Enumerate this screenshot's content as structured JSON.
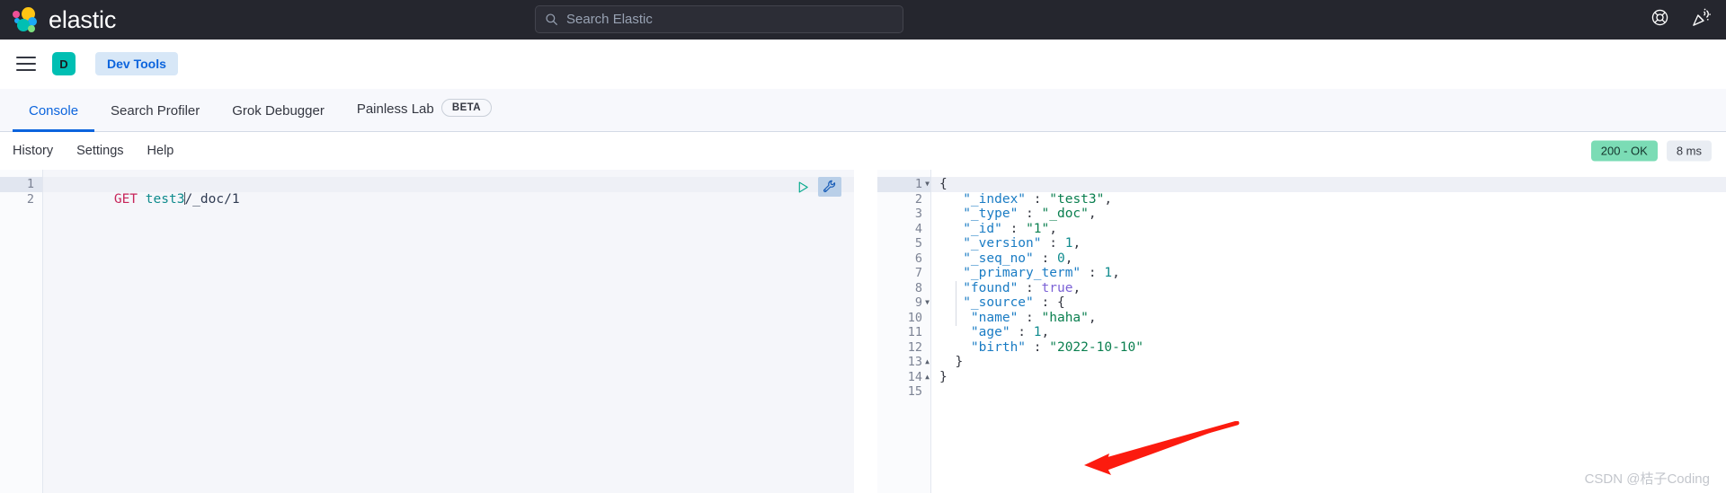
{
  "topbar": {
    "brand": "elastic",
    "logo_colors": {
      "pink": "#ee5097",
      "yellow": "#fec514",
      "cyan": "#1ba9f5",
      "teal": "#00bfb3",
      "green": "#7de07d"
    },
    "search": {
      "placeholder": "Search Elastic",
      "value": ""
    },
    "icons": [
      "help-lifebuoy-icon",
      "confetti-icon"
    ],
    "background": "#25262e"
  },
  "navbar": {
    "menu_icon": "hamburger-menu-icon",
    "avatar_initial": "D",
    "avatar_color": "#00bfb3",
    "breadcrumb": "Dev Tools",
    "breadcrumb_color": "#0b64dd"
  },
  "tabs": {
    "items": [
      {
        "label": "Console",
        "active": true
      },
      {
        "label": "Search Profiler",
        "active": false
      },
      {
        "label": "Grok Debugger",
        "active": false
      },
      {
        "label": "Painless Lab",
        "active": false
      }
    ],
    "beta_badge": "BETA",
    "accent": "#0b64dd"
  },
  "toolrow": {
    "links": [
      "History",
      "Settings",
      "Help"
    ],
    "status": "200 - OK",
    "status_color": "#7bdcb5",
    "duration": "8 ms"
  },
  "request_editor": {
    "actions": [
      "play-request-icon",
      "wrench-icon"
    ],
    "line_numbers": [
      "1",
      "2"
    ],
    "method": "GET",
    "index": "test3",
    "path": "/_doc/1"
  },
  "response_editor": {
    "lines": [
      {
        "num": "1",
        "fold": "down",
        "text": "{"
      },
      {
        "num": "2",
        "fold": "",
        "key": "\"_index\"",
        "sep": " : ",
        "value": "\"test3\"",
        "type": "str",
        "comma": ","
      },
      {
        "num": "3",
        "fold": "",
        "key": "\"_type\"",
        "sep": " : ",
        "value": "\"_doc\"",
        "type": "str",
        "comma": ","
      },
      {
        "num": "4",
        "fold": "",
        "key": "\"_id\"",
        "sep": " : ",
        "value": "\"1\"",
        "type": "str",
        "comma": ","
      },
      {
        "num": "5",
        "fold": "",
        "key": "\"_version\"",
        "sep": " : ",
        "value": "1",
        "type": "num",
        "comma": ","
      },
      {
        "num": "6",
        "fold": "",
        "key": "\"_seq_no\"",
        "sep": " : ",
        "value": "0",
        "type": "num",
        "comma": ","
      },
      {
        "num": "7",
        "fold": "",
        "key": "\"_primary_term\"",
        "sep": " : ",
        "value": "1",
        "type": "num",
        "comma": ","
      },
      {
        "num": "8",
        "fold": "",
        "key": "\"found\"",
        "sep": " : ",
        "value": "true",
        "type": "bool",
        "comma": ","
      },
      {
        "num": "9",
        "fold": "down",
        "key": "\"_source\"",
        "sep": " : ",
        "value": "{",
        "type": "punc",
        "comma": ""
      },
      {
        "num": "10",
        "fold": "",
        "key": "\"name\"",
        "sep": " : ",
        "value": "\"haha\"",
        "type": "str",
        "comma": ","
      },
      {
        "num": "11",
        "fold": "",
        "key": "\"age\"",
        "sep": " : ",
        "value": "1",
        "type": "num",
        "comma": ","
      },
      {
        "num": "12",
        "fold": "",
        "key": "\"birth\"",
        "sep": " : ",
        "value": "\"2022-10-10\"",
        "type": "str",
        "comma": ""
      },
      {
        "num": "13",
        "fold": "up",
        "text": "}"
      },
      {
        "num": "14",
        "fold": "up",
        "text": "}"
      },
      {
        "num": "15",
        "fold": "",
        "text": ""
      }
    ]
  },
  "annotation": {
    "type": "arrow",
    "color": "#fc1b0f",
    "points_to": "_version line"
  },
  "watermark": "CSDN @桔子Coding"
}
